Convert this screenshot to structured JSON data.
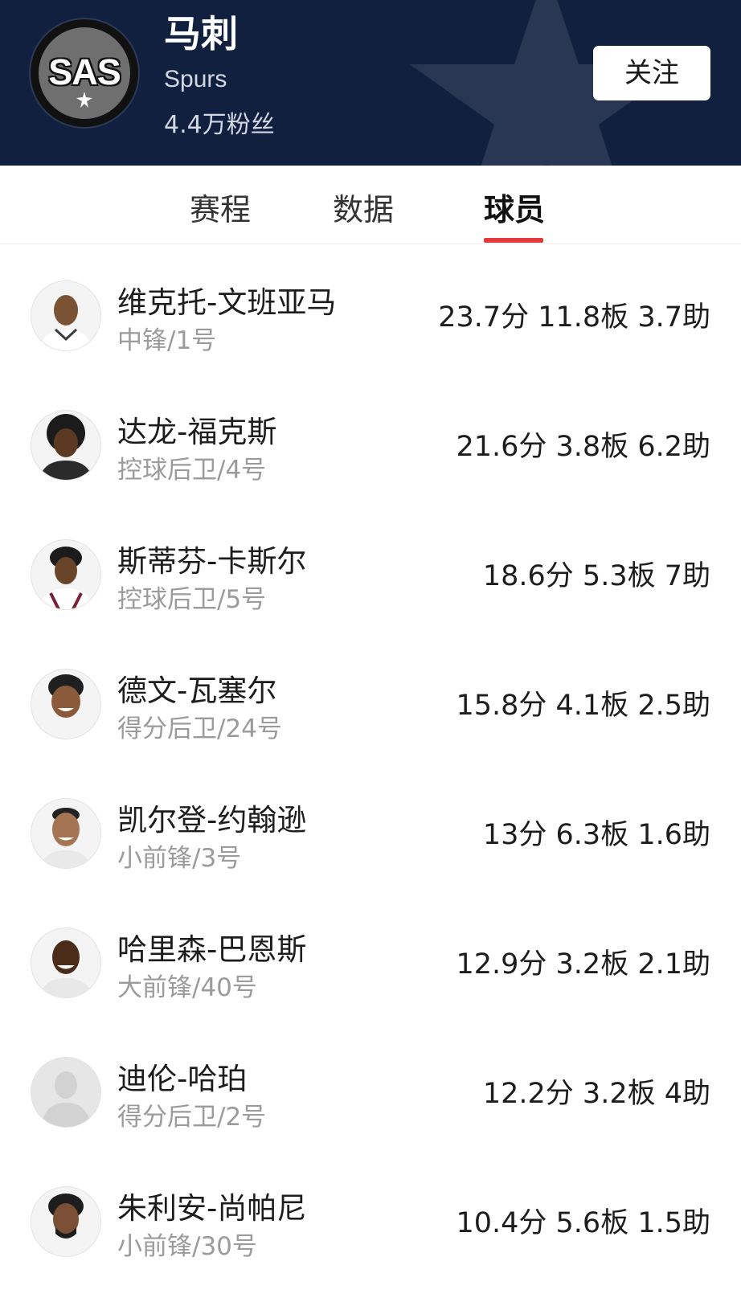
{
  "team": {
    "name": "马刺",
    "name_en": "Spurs",
    "fans": "4.4万粉丝",
    "logo_text": "SAS",
    "follow_label": "关注"
  },
  "tabs": [
    {
      "label": "赛程",
      "active": false
    },
    {
      "label": "数据",
      "active": false
    },
    {
      "label": "球员",
      "active": true
    }
  ],
  "players": [
    {
      "name": "维克托-文班亚马",
      "position": "中锋/1号",
      "stats": "23.7分 11.8板 3.7助",
      "avatar": "player-photo"
    },
    {
      "name": "达龙-福克斯",
      "position": "控球后卫/4号",
      "stats": "21.6分 3.8板 6.2助",
      "avatar": "player-photo"
    },
    {
      "name": "斯蒂芬-卡斯尔",
      "position": "控球后卫/5号",
      "stats": "18.6分 5.3板 7助",
      "avatar": "player-photo"
    },
    {
      "name": "德文-瓦塞尔",
      "position": "得分后卫/24号",
      "stats": "15.8分 4.1板 2.5助",
      "avatar": "player-photo"
    },
    {
      "name": "凯尔登-约翰逊",
      "position": "小前锋/3号",
      "stats": "13分 6.3板 1.6助",
      "avatar": "player-photo"
    },
    {
      "name": "哈里森-巴恩斯",
      "position": "大前锋/40号",
      "stats": "12.9分 3.2板 2.1助",
      "avatar": "player-photo"
    },
    {
      "name": "迪伦-哈珀",
      "position": "得分后卫/2号",
      "stats": "12.2分 3.2板 4助",
      "avatar": "default-avatar-placeholder"
    },
    {
      "name": "朱利安-尚帕尼",
      "position": "小前锋/30号",
      "stats": "10.4分 5.6板 1.5助",
      "avatar": "player-photo"
    }
  ],
  "colors": {
    "header_bg": "#11203f",
    "tab_indicator": "#e0393e",
    "secondary_text": "#9b9b9b"
  }
}
